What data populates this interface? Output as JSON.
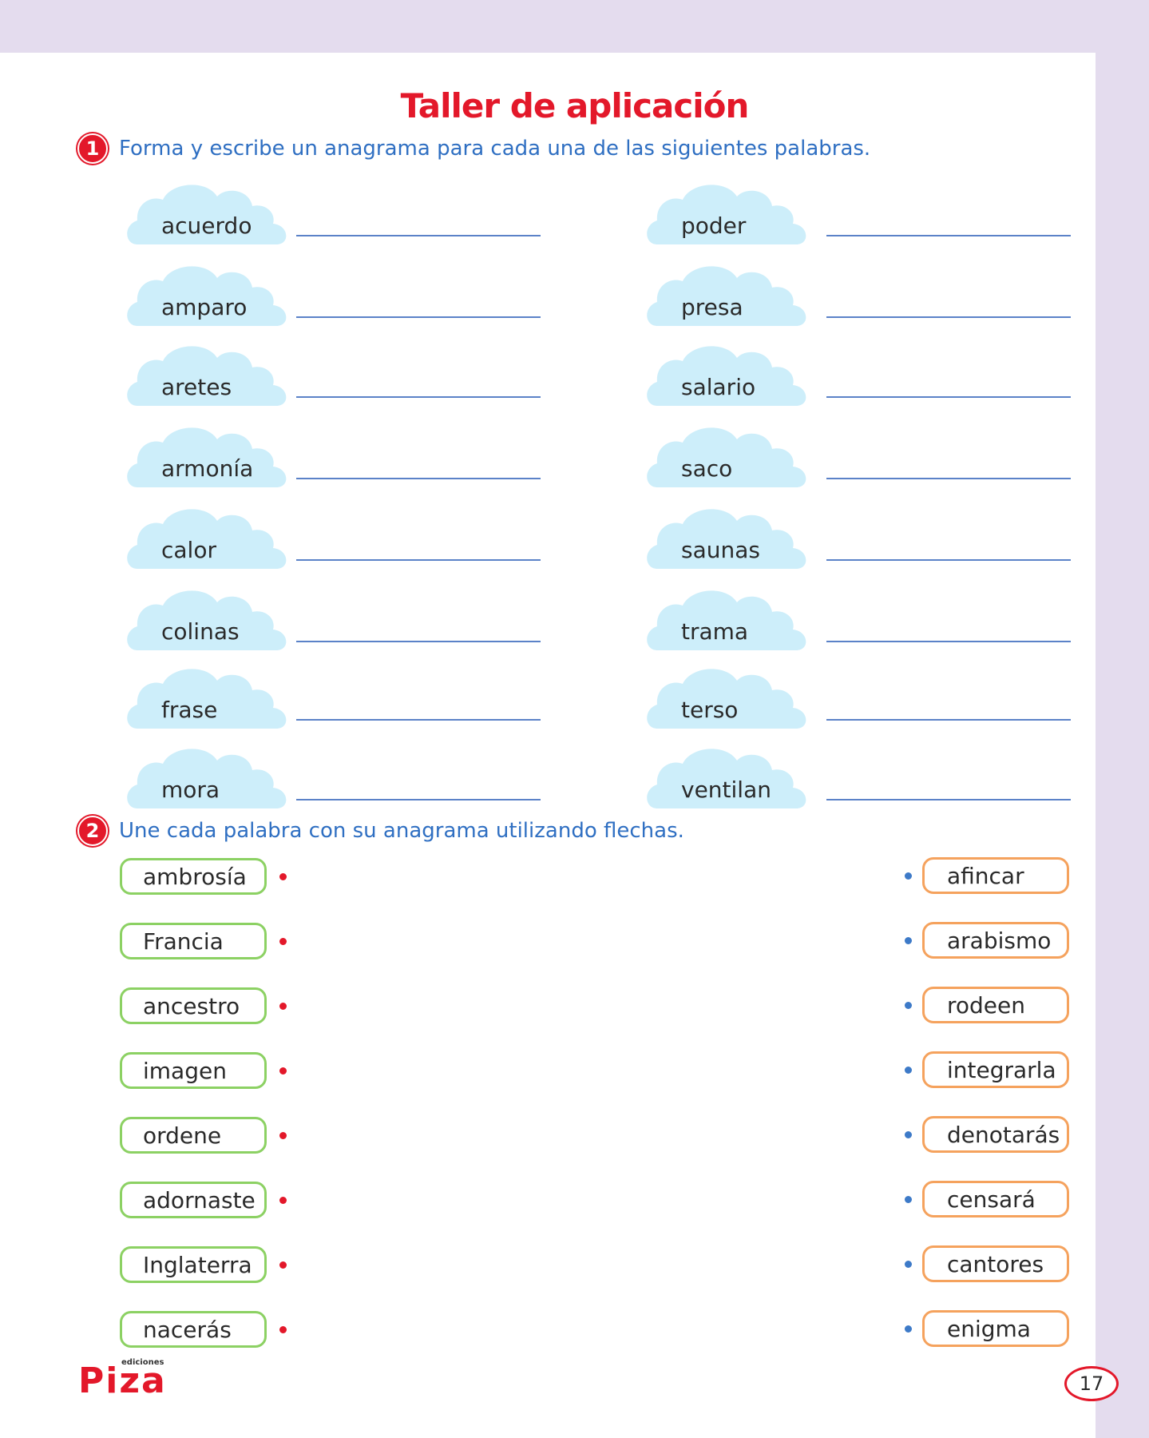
{
  "title": "Taller de aplicación",
  "activity1": {
    "number": "1",
    "instruction": "Forma y escribe un anagrama para cada una de las siguientes palabras.",
    "left_words": [
      "acuerdo",
      "amparo",
      "aretes",
      "armonía",
      "calor",
      "colinas",
      "frase",
      "mora"
    ],
    "right_words": [
      "poder",
      "presa",
      "salario",
      "saco",
      "saunas",
      "trama",
      "terso",
      "ventilan"
    ]
  },
  "activity2": {
    "number": "2",
    "instruction": "Une cada palabra con su anagrama utilizando flechas.",
    "left_words": [
      "ambrosía",
      "Francia",
      "ancestro",
      "imagen",
      "ordene",
      "adornaste",
      "Inglaterra",
      "nacerás"
    ],
    "right_words": [
      "afincar",
      "arabismo",
      "rodeen",
      "integrarla",
      "denotarás",
      "censará",
      "cantores",
      "enigma"
    ]
  },
  "footer": {
    "logo_text": "Piza",
    "logo_small": "ediciones",
    "page_number": "17"
  },
  "colors": {
    "title_red": "#e3182a",
    "instruction_blue": "#2f6fc2",
    "cloud": "#cdeefa",
    "line": "#5b82c8",
    "pill_green": "#8cd163",
    "pill_orange": "#f5a25d",
    "background_lavender": "#e4dcee"
  }
}
